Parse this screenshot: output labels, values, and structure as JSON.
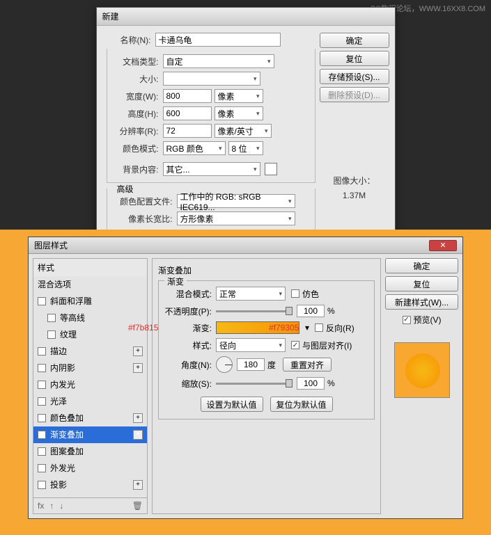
{
  "watermark": "PS教程论坛，WWW.16XX8.COM",
  "dlg1": {
    "title": "新建",
    "labels": {
      "name": "名称(N):",
      "doctype": "文档类型:",
      "size": "大小:",
      "width": "宽度(W):",
      "height": "高度(H):",
      "resolution": "分辨率(R):",
      "colormode": "颜色模式:",
      "bgcontent": "背景内容:",
      "advanced": "高级",
      "profile": "颜色配置文件:",
      "aspect": "像素长宽比:"
    },
    "values": {
      "name": "卡通乌龟",
      "doctype": "自定",
      "width": "800",
      "height": "600",
      "resolution": "72",
      "colormode": "RGB 颜色",
      "bits": "8 位",
      "bgcontent": "其它...",
      "profile": "工作中的 RGB: sRGB IEC619...",
      "aspect": "方形像素",
      "unit_px": "像素",
      "unit_res": "像素/英寸"
    },
    "buttons": {
      "ok": "确定",
      "reset": "复位",
      "savepreset": "存储预设(S)...",
      "deletepreset": "删除预设(D)..."
    },
    "imagesize": {
      "label": "图像大小：",
      "value": "1.37M"
    }
  },
  "dlg2": {
    "title": "图层样式",
    "styles_header": "样式",
    "blend_options": "混合选项",
    "items": [
      {
        "label": "斜面和浮雕",
        "checked": false,
        "plus": false
      },
      {
        "label": "等高线",
        "checked": false,
        "plus": false,
        "indent": true
      },
      {
        "label": "纹理",
        "checked": false,
        "plus": false,
        "indent": true
      },
      {
        "label": "描边",
        "checked": false,
        "plus": true
      },
      {
        "label": "内阴影",
        "checked": false,
        "plus": true
      },
      {
        "label": "内发光",
        "checked": false,
        "plus": false
      },
      {
        "label": "光泽",
        "checked": false,
        "plus": false
      },
      {
        "label": "颜色叠加",
        "checked": false,
        "plus": true
      },
      {
        "label": "渐变叠加",
        "checked": true,
        "plus": true,
        "selected": true
      },
      {
        "label": "图案叠加",
        "checked": false,
        "plus": false
      },
      {
        "label": "外发光",
        "checked": false,
        "plus": false
      },
      {
        "label": "投影",
        "checked": false,
        "plus": true
      }
    ],
    "footer": {
      "fx": "fx",
      "up": "✦",
      "down": "✦",
      "trash": "🗑"
    },
    "options": {
      "title": "渐变叠加",
      "legend": "渐变",
      "labels": {
        "blendmode": "混合模式:",
        "opacity": "不透明度(P):",
        "gradient": "渐变:",
        "style": "样式:",
        "angle": "角度(N):",
        "scale": "缩放(S):",
        "dither": "仿色",
        "reverse": "反向(R)",
        "align": "与图层对齐(I)",
        "deg": "度",
        "realign": "重置对齐"
      },
      "values": {
        "blendmode": "正常",
        "opacity": "100",
        "style": "径向",
        "angle": "180",
        "scale": "100"
      },
      "buttons": {
        "setdefault": "设置为默认值",
        "resetdefault": "复位为默认值"
      },
      "annot1": "#f7b815",
      "annot2": "#f79305"
    },
    "buttons": {
      "ok": "确定",
      "reset": "复位",
      "newstyle": "新建样式(W)...",
      "preview": "预览(V)"
    }
  }
}
